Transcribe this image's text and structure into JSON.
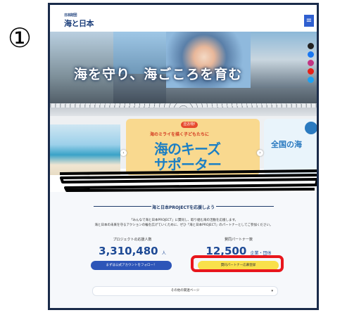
{
  "step_marker": "①",
  "header": {
    "logo_small": "日本財団",
    "logo_text": "海と日本",
    "menu_label": "≡"
  },
  "hero": {
    "title": "海を守り、海ごころを育む"
  },
  "carousel": {
    "left_arrow": "‹",
    "right_arrow": "›",
    "main_slide": {
      "badge": "应お物!",
      "subtitle": "海のミライを描く子どもたちに",
      "headline_line1": "海のキーズ",
      "headline_line2": "サポーター"
    },
    "right_slide": {
      "text": "全国の海"
    }
  },
  "support": {
    "title": "海と日本PROJECTを応援しよう",
    "desc_line1": "「みんなで海と日本PROJECT」に賛同し、取り組む海の活動を応援します。",
    "desc_line2": "海と日本の未来を守るアクションの輪を広げていくために、ぜひ「海と日本PROJECT」のパートナーとしてご参加ください。",
    "stat1_label": "プロジェクトの応援人数",
    "stat1_value": "3,310,480",
    "stat1_unit": "人",
    "stat2_label": "賛同パートナー数",
    "stat2_value": "12,500",
    "stat2_unit": "企業・団体",
    "button_blue": "まずは公式アカウントをフォロー！",
    "button_yellow": "賛同パートナー応募登録",
    "dropdown_label": "その他の関連ページ"
  },
  "colors": {
    "accent_blue": "#2d55b8",
    "accent_yellow": "#f9e04b",
    "highlight_red": "#e8161c",
    "frame": "#1a2b4a"
  }
}
